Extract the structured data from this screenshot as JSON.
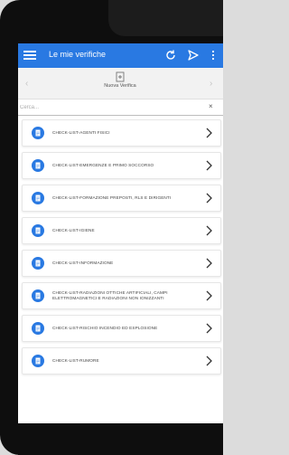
{
  "app_bar": {
    "title": "Le mie verifiche",
    "icons": [
      "menu-icon",
      "refresh-icon",
      "send-icon",
      "more-icon"
    ],
    "accent_color": "#2979e2"
  },
  "sub_bar": {
    "new_label": "Nuova Verifica",
    "new_icon": "new-document-icon"
  },
  "search": {
    "placeholder": "Cerca...",
    "value": "",
    "clear_icon": "×"
  },
  "items": [
    {
      "label": "CHECK-LIST-AGENTI FISICI"
    },
    {
      "label": "CHECK-LIST-EMERGENZE E PRIMO SOCCORSO"
    },
    {
      "label": "CHECK-LIST-FORMAZIONE PREPOSTI, RLS E DIRIGENTI"
    },
    {
      "label": "CHECK-LIST-IGIENE"
    },
    {
      "label": "CHECK-LIST-INFORMAZIONE"
    },
    {
      "label": "CHECK-LIST-RADIAZIONI OTTICHE ARTIFICIALI, CAMPI ELETTROMAGNETICI E RADIAZIONI NON IONIZZANTI"
    },
    {
      "label": "CHECK-LIST-RISCHIO INCENDIO ED ESPLOSIONE"
    },
    {
      "label": "CHECK-LIST-RUMORE"
    }
  ]
}
